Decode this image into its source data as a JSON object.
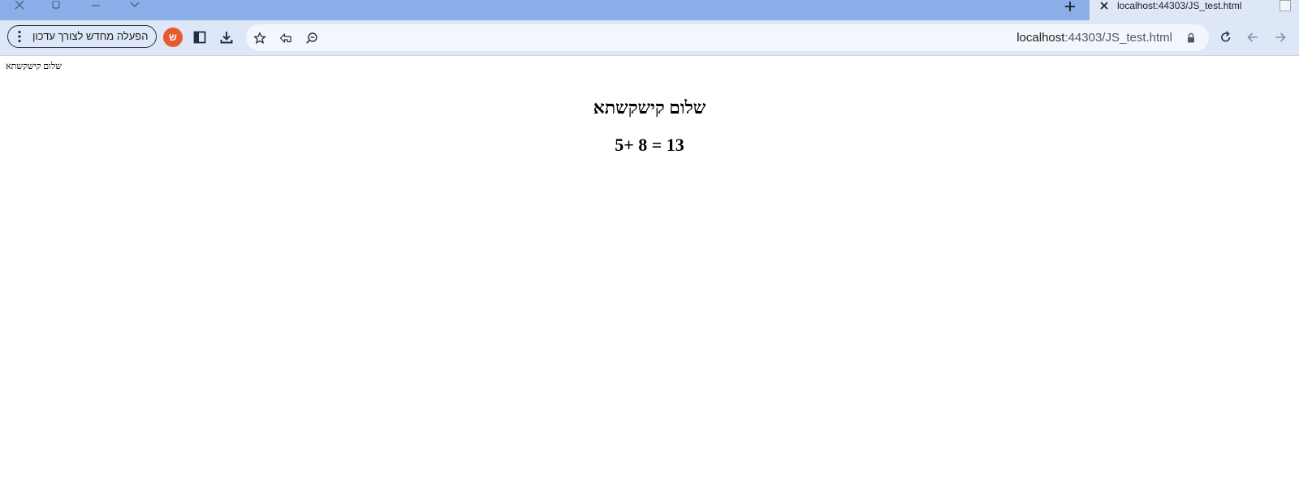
{
  "browser": {
    "tab": {
      "title": "localhost:44303/JS_test.html"
    },
    "address_bar": {
      "host": "localhost",
      "path": ":44303/JS_test.html"
    },
    "update_button": {
      "label": "הפעלה מחדש לצורך עדכון"
    },
    "profile_avatar": {
      "letter": "ש",
      "color": "#e65b2b"
    },
    "icons": {
      "window_close": "close-icon",
      "window_restore": "restore-icon",
      "window_minimize": "minimize-icon",
      "tab_search": "chevron-down-icon",
      "new_tab": "plus-icon",
      "tab_close": "close-icon",
      "reload": "reload-icon",
      "back": "back-arrow-icon",
      "forward": "forward-arrow-icon",
      "bookmark": "star-icon",
      "share": "share-icon",
      "zoom": "zoom-icon",
      "lock": "lock-icon",
      "downloads": "download-icon",
      "side_panel": "side-panel-icon",
      "menu": "kebab-menu-icon"
    },
    "colors": {
      "titlebar": "#8aaee8",
      "toolbar": "#dde7f7",
      "omnibox": "#f3f6fc"
    }
  },
  "page": {
    "small_text": "שלום קישקשתא",
    "heading": "שלום קישקשתא",
    "sum_line": "5+ 8 = 13"
  }
}
